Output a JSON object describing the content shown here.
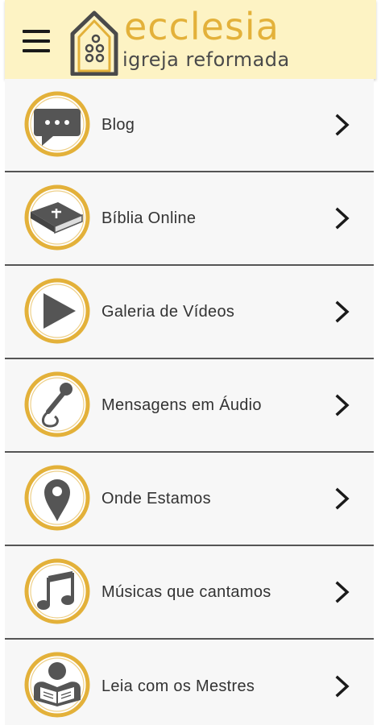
{
  "header": {
    "menu_icon": "hamburger-icon",
    "logo": {
      "title": "ecclesia",
      "subtitle": "igreja reformada",
      "icon": "church-house-icon",
      "title_color": "#e3b13a",
      "subtitle_color": "#4a4a4a"
    },
    "background": "#fdf3c4"
  },
  "menu": {
    "items": [
      {
        "label": "Blog",
        "icon": "chat-bubble-icon"
      },
      {
        "label": "Bíblia Online",
        "icon": "bible-icon"
      },
      {
        "label": "Galeria de Vídeos",
        "icon": "play-icon"
      },
      {
        "label": "Mensagens em Áudio",
        "icon": "microphone-icon"
      },
      {
        "label": "Onde Estamos",
        "icon": "location-pin-icon"
      },
      {
        "label": "Músicas que cantamos",
        "icon": "music-note-icon"
      },
      {
        "label": "Leia com os Mestres",
        "icon": "reader-icon"
      }
    ],
    "chevron_icon": "chevron-right-icon",
    "ring_color": "#e3b13a",
    "icon_color": "#555555"
  }
}
